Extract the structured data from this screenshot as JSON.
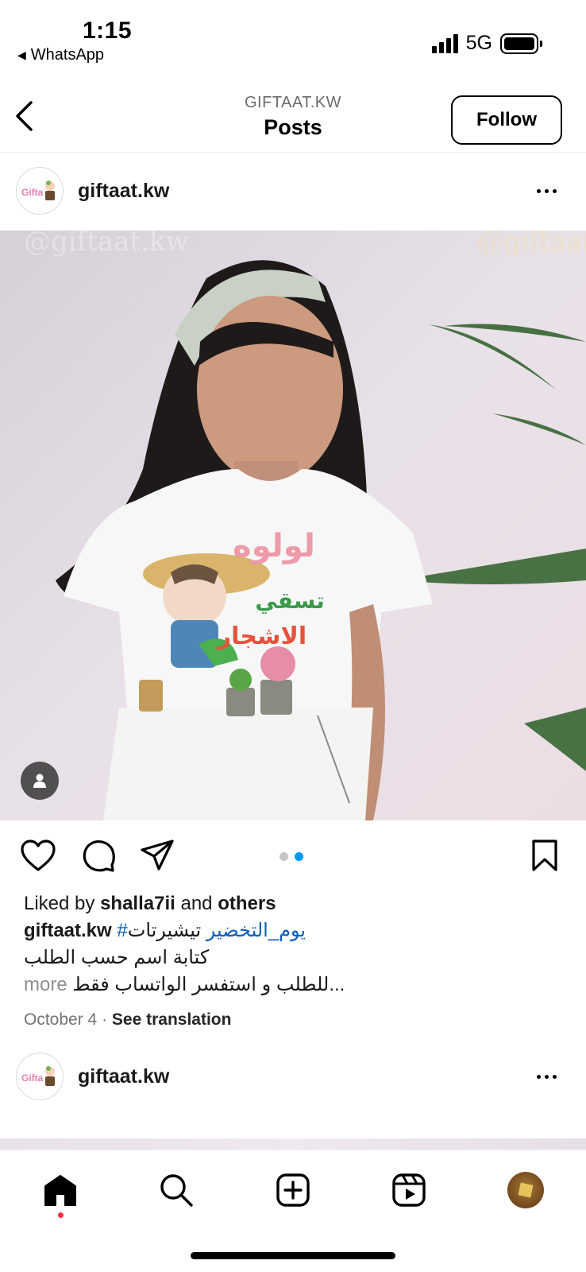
{
  "status_bar": {
    "time": "1:15",
    "back_app": "WhatsApp",
    "network": "5G"
  },
  "header": {
    "subtitle": "GIFTAAT.KW",
    "title": "Posts",
    "follow_label": "Follow"
  },
  "post": {
    "username": "giftaat.kw",
    "image": {
      "description_icon": "person-tag-icon",
      "watermark": "@giftaat.kw",
      "shirt_text_line1": "لولوه",
      "shirt_text_line2": "تسقي",
      "shirt_text_line3": "الاشجار"
    },
    "carousel": {
      "count": 2,
      "active_index": 1
    },
    "liked_by_prefix": "Liked by",
    "liked_by_user": "shalla7ii",
    "liked_by_and": "and",
    "liked_by_others": "others",
    "caption_username": "giftaat.kw",
    "caption_hashtag": "#يوم_التخضير",
    "caption_text1": "تيشيرتات",
    "caption_line2": "كتابة اسم حسب الطلب",
    "caption_line3": "للطلب و استفسر الواتساب فقط...",
    "more_label": "more",
    "date": "October 4",
    "separator": "·",
    "see_translation": "See translation"
  },
  "next_post": {
    "username": "giftaat.kw"
  },
  "colors": {
    "accent_blue": "#0095f6",
    "hashtag": "#0a5db8",
    "notification_red": "#ff3040"
  }
}
